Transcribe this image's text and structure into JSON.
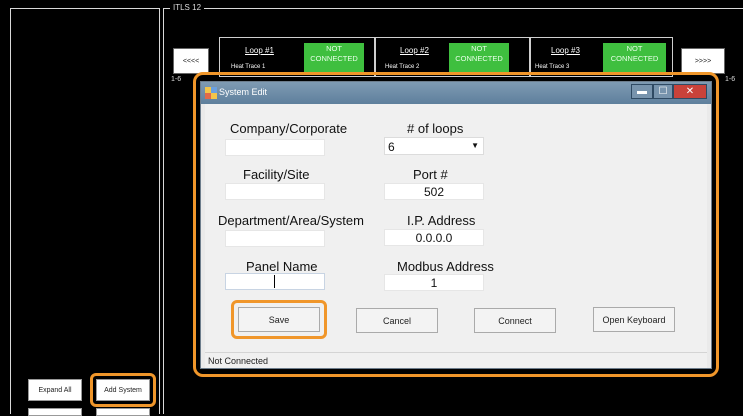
{
  "group": {
    "title": "ITLS 12"
  },
  "nav": {
    "prev": "<<<<",
    "next": ">>>>"
  },
  "loops": [
    {
      "name": "Loop #1",
      "sub": "Heat Trace 1",
      "status": "NOT CONNECTED"
    },
    {
      "name": "Loop #2",
      "sub": "Heat Trace 2",
      "status": "NOT CONNECTED"
    },
    {
      "name": "Loop #3",
      "sub": "Heat Trace 3",
      "status": "NOT CONNECTED"
    }
  ],
  "edge_labels": {
    "left": "1-6",
    "right": "1-6"
  },
  "left_panel": {
    "expand_all": "Expand All",
    "add_system": "Add System"
  },
  "dialog": {
    "title": "System Edit",
    "controls": {
      "minimize": "▬",
      "maximize": "☐",
      "close": "✕"
    },
    "fields": {
      "company": {
        "label": "Company/Corporate",
        "value": ""
      },
      "facility": {
        "label": "Facility/Site",
        "value": ""
      },
      "department": {
        "label": "Department/Area/System",
        "value": ""
      },
      "panel_name": {
        "label": "Panel Name",
        "value": ""
      },
      "loops": {
        "label": "# of loops",
        "value": "6"
      },
      "port": {
        "label": "Port #",
        "value": "502"
      },
      "ip": {
        "label": "I.P. Address",
        "value": "0.0.0.0"
      },
      "modbus": {
        "label": "Modbus Address",
        "value": "1"
      }
    },
    "buttons": {
      "save": "Save",
      "cancel": "Cancel",
      "connect": "Connect",
      "keyboard": "Open Keyboard"
    },
    "status": "Not Connected"
  },
  "colors": {
    "highlight": "#f0962a",
    "status_green": "#3fbf3f",
    "titlebar": "#6f8ca7",
    "close": "#c9423a"
  }
}
